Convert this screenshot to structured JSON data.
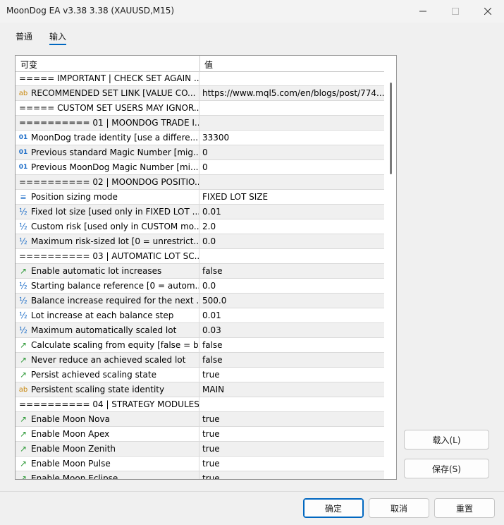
{
  "window": {
    "title": "MoonDog EA v3.38 3.38 (XAUUSD,M15)"
  },
  "tabs": [
    {
      "label": "普通"
    },
    {
      "label": "输入"
    }
  ],
  "grid": {
    "col_variable": "可变",
    "col_value": "值",
    "rows": [
      {
        "icon": "",
        "name": "===== IMPORTANT | CHECK SET AGAIN ...",
        "value": ""
      },
      {
        "icon": "ab",
        "name": "RECOMMENDED SET LINK [VALUE CO...",
        "value": "https://www.mql5.com/en/blogs/post/774..."
      },
      {
        "icon": "",
        "name": "===== CUSTOM SET USERS MAY IGNOR...",
        "value": ""
      },
      {
        "icon": "",
        "name": "========== 01 | MOONDOG TRADE I...",
        "value": ""
      },
      {
        "icon": "01",
        "name": "MoonDog trade identity [use a differe...",
        "value": "33300"
      },
      {
        "icon": "01",
        "name": "Previous standard Magic Number [mig...",
        "value": "0"
      },
      {
        "icon": "01",
        "name": "Previous MoonDog Magic Number [mi...",
        "value": "0"
      },
      {
        "icon": "",
        "name": "========== 02 | MOONDOG POSITIO...",
        "value": ""
      },
      {
        "icon": "enum",
        "name": "Position sizing mode",
        "value": "FIXED LOT SIZE"
      },
      {
        "icon": "½",
        "name": "Fixed lot size [used only in FIXED LOT ...",
        "value": "0.01"
      },
      {
        "icon": "½",
        "name": "Custom risk [used only in CUSTOM mo...",
        "value": "2.0"
      },
      {
        "icon": "½",
        "name": "Maximum risk-sized lot [0 = unrestrict...",
        "value": "0.0"
      },
      {
        "icon": "",
        "name": "========== 03 | AUTOMATIC LOT SC...",
        "value": ""
      },
      {
        "icon": "bool",
        "name": "Enable automatic lot increases",
        "value": "false"
      },
      {
        "icon": "½",
        "name": "Starting balance reference [0 = autom...",
        "value": "0.0"
      },
      {
        "icon": "½",
        "name": "Balance increase required for the next ...",
        "value": "500.0"
      },
      {
        "icon": "½",
        "name": "Lot increase at each balance step",
        "value": "0.01"
      },
      {
        "icon": "½",
        "name": "Maximum automatically scaled lot",
        "value": "0.03"
      },
      {
        "icon": "bool",
        "name": "Calculate scaling from equity [false = b...",
        "value": "false"
      },
      {
        "icon": "bool",
        "name": "Never reduce an achieved scaled lot",
        "value": "false"
      },
      {
        "icon": "bool",
        "name": "Persist achieved scaling state",
        "value": "true"
      },
      {
        "icon": "ab",
        "name": "Persistent scaling state identity",
        "value": "MAIN"
      },
      {
        "icon": "",
        "name": "========== 04 | STRATEGY MODULES...",
        "value": ""
      },
      {
        "icon": "bool",
        "name": "Enable Moon Nova",
        "value": "true"
      },
      {
        "icon": "bool",
        "name": "Enable Moon Apex",
        "value": "true"
      },
      {
        "icon": "bool",
        "name": "Enable Moon Zenith",
        "value": "true"
      },
      {
        "icon": "bool",
        "name": "Enable Moon Pulse",
        "value": "true"
      },
      {
        "icon": "bool",
        "name": "Enable Moon Eclipse",
        "value": "true"
      }
    ]
  },
  "side_buttons": {
    "load": "载入(L)",
    "save": "保存(S)"
  },
  "footer_buttons": {
    "ok": "确定",
    "cancel": "取消",
    "reset": "重置"
  }
}
